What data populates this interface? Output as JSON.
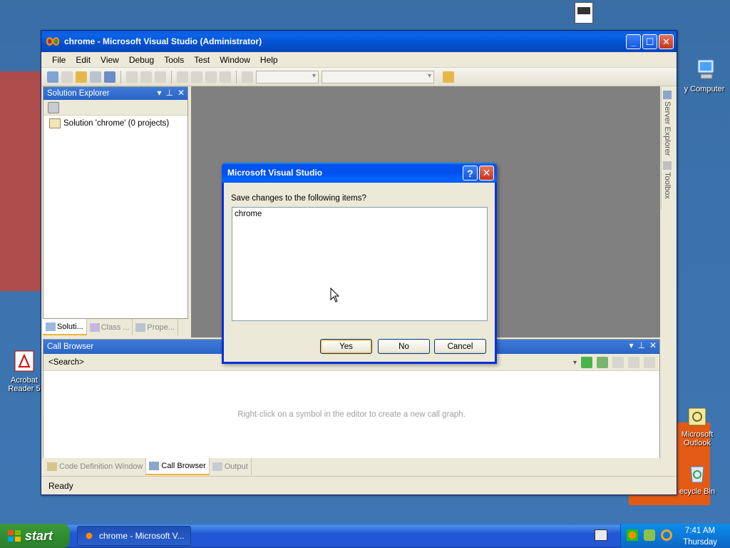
{
  "desktop": {
    "icons": [
      {
        "id": "my-computer",
        "label": "y Computer"
      },
      {
        "id": "acrobat",
        "label_line1": "Acrobat",
        "label_line2": "Reader 5"
      },
      {
        "id": "outlook",
        "label_line1": "Microsoft",
        "label_line2": "Outlook"
      },
      {
        "id": "recycle",
        "label": "ecycle Bin"
      }
    ]
  },
  "vs_window": {
    "title": "chrome - Microsoft Visual Studio (Administrator)",
    "menu": [
      "File",
      "Edit",
      "View",
      "Debug",
      "Tools",
      "Test",
      "Window",
      "Help"
    ],
    "solution_explorer": {
      "title": "Solution Explorer",
      "item": "Solution 'chrome' (0 projects)",
      "tabs": [
        "Soluti...",
        "Class ...",
        "Prope..."
      ]
    },
    "side_tabs": [
      "Server Explorer",
      "Toolbox"
    ],
    "call_browser": {
      "title": "Call Browser",
      "search": "<Search>",
      "hint": "Right-click on a symbol in the editor to create a new call graph."
    },
    "bottom_tabs": [
      "Code Definition Window",
      "Call Browser",
      "Output"
    ],
    "status": "Ready"
  },
  "dialog": {
    "title": "Microsoft Visual Studio",
    "help_glyph": "?",
    "close_glyph": "✕",
    "prompt": "Save changes to the following items?",
    "items": [
      "chrome"
    ],
    "buttons": {
      "yes": "Yes",
      "no": "No",
      "cancel": "Cancel"
    }
  },
  "taskbar": {
    "start": "start",
    "task": "chrome - Microsoft V...",
    "time": "7:41 AM",
    "day": "Thursday"
  },
  "colors": {
    "desktop": "#3a6ea5",
    "titlebar": "#0a5ad8",
    "panel_header": "#3d7bd8",
    "taskbar": "#2157d7",
    "start_green": "#3c9a3c"
  }
}
